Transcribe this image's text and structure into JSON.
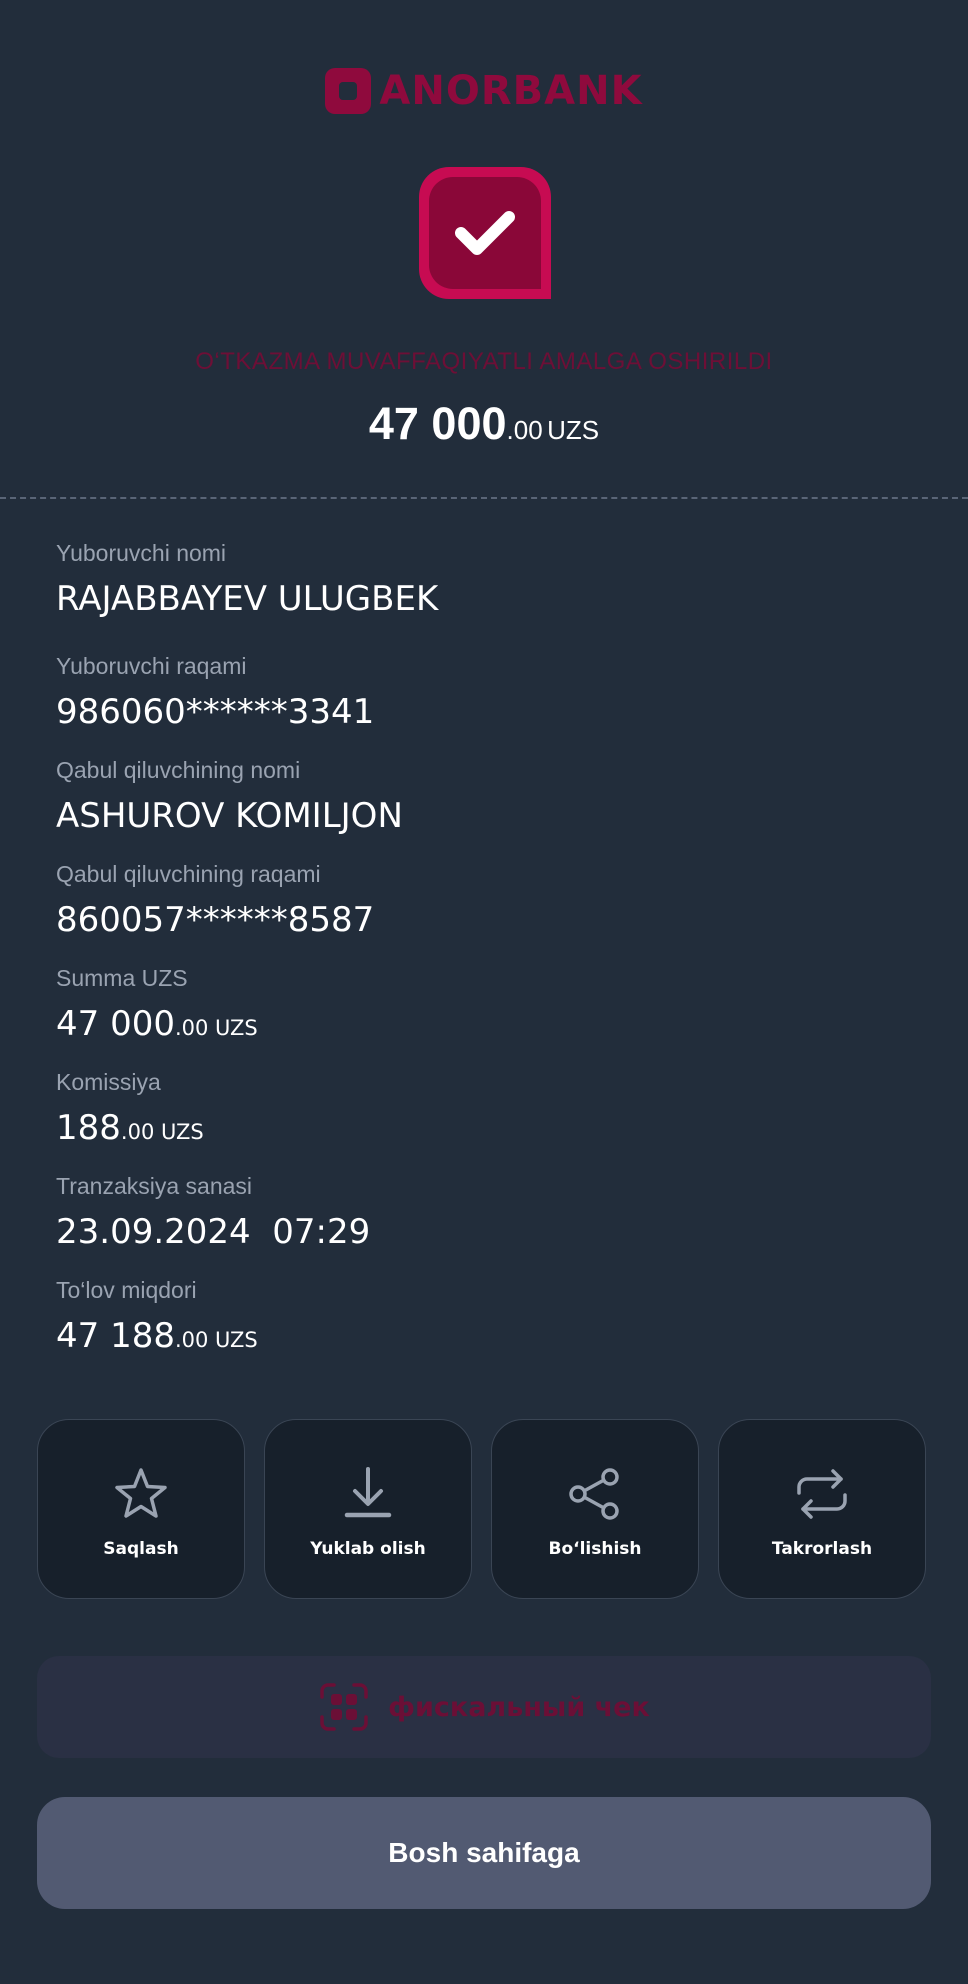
{
  "header": {
    "logo_text": "ANORBANK",
    "status": "O‘TKAZMA MUVAFFAQIYATLI AMALGA OSHIRILDI",
    "amount_main": "47 000",
    "amount_frac": ".00",
    "amount_currency": "UZS"
  },
  "details": [
    {
      "label": "Yuboruvchi nomi",
      "value": "RAJABBAYEV ULUGBEK"
    },
    {
      "label": "Yuboruvchi raqami",
      "value": "986060******3341"
    },
    {
      "label": "Qabul qiluvchining nomi",
      "value": "ASHUROV KOMILJON"
    },
    {
      "label": "Qabul qiluvchining raqami",
      "value": "860057******8587"
    },
    {
      "label": "Summa UZS",
      "value": "47 000",
      "frac": ".00 UZS"
    },
    {
      "label": "Komissiya",
      "value": "188",
      "frac": ".00 UZS"
    },
    {
      "label": "Tranzaksiya sanasi",
      "value": "23.09.2024  07:29"
    },
    {
      "label": "To‘lov miqdori",
      "value": "47 188",
      "frac": ".00 UZS"
    }
  ],
  "actions": [
    {
      "label": "Saqlash",
      "icon": "star-icon"
    },
    {
      "label": "Yuklab olish",
      "icon": "download-icon"
    },
    {
      "label": "Bo‘lishish",
      "icon": "share-icon"
    },
    {
      "label": "Takrorlash",
      "icon": "repeat-icon"
    }
  ],
  "fiscal": {
    "label": "фискальный чек",
    "icon": "receipt-grid-icon"
  },
  "home_button": {
    "label": "Bosh sahifaga"
  },
  "colors": {
    "background": "#222d3b",
    "brand": "#8f0a3d",
    "accent_pink": "#c70b52",
    "button": "#525a72"
  }
}
